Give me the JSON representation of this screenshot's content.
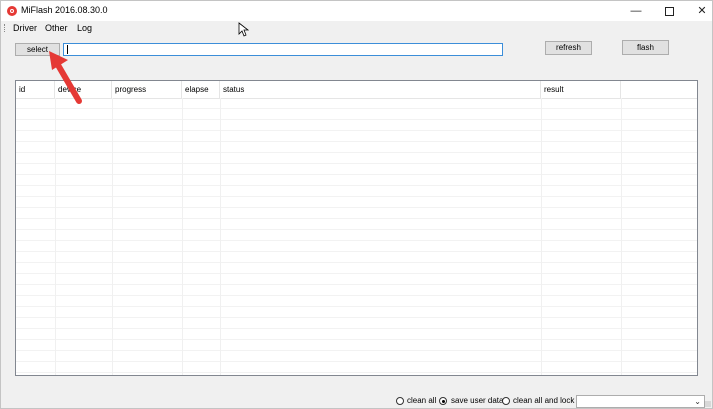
{
  "window": {
    "title": "MiFlash 2016.08.30.0",
    "controls": {
      "minimize": "—",
      "maximize": "",
      "close": "✕"
    }
  },
  "menu": {
    "items": [
      "Driver",
      "Other",
      "Log"
    ]
  },
  "toolbar": {
    "select_label": "select",
    "path_value": "",
    "refresh_label": "refresh",
    "flash_label": "flash"
  },
  "grid": {
    "columns": [
      "id",
      "device",
      "progress",
      "elapse",
      "status",
      "result"
    ],
    "rows": []
  },
  "statusbar": {
    "options": [
      {
        "label": "clean all",
        "checked": false
      },
      {
        "label": "save user data",
        "checked": true
      },
      {
        "label": "clean all and lock",
        "checked": false
      }
    ],
    "dropdown_value": ""
  },
  "colors": {
    "annotation_arrow": "#e53935",
    "input_border": "#3c8ed9",
    "window_bg": "#f0f0f0"
  },
  "icons": [
    "app-logo-icon",
    "minimize-icon",
    "maximize-icon",
    "close-icon",
    "chevron-down-icon",
    "mouse-cursor-icon",
    "red-arrow-annotation"
  ]
}
